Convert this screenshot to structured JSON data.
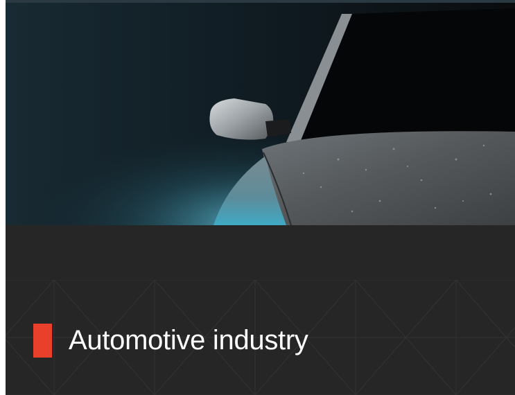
{
  "card": {
    "title": "Automotive industry",
    "image_subject": "car-photo",
    "accent_color": "#e8402a",
    "background_color": "#262626",
    "title_color": "#ffffff"
  }
}
